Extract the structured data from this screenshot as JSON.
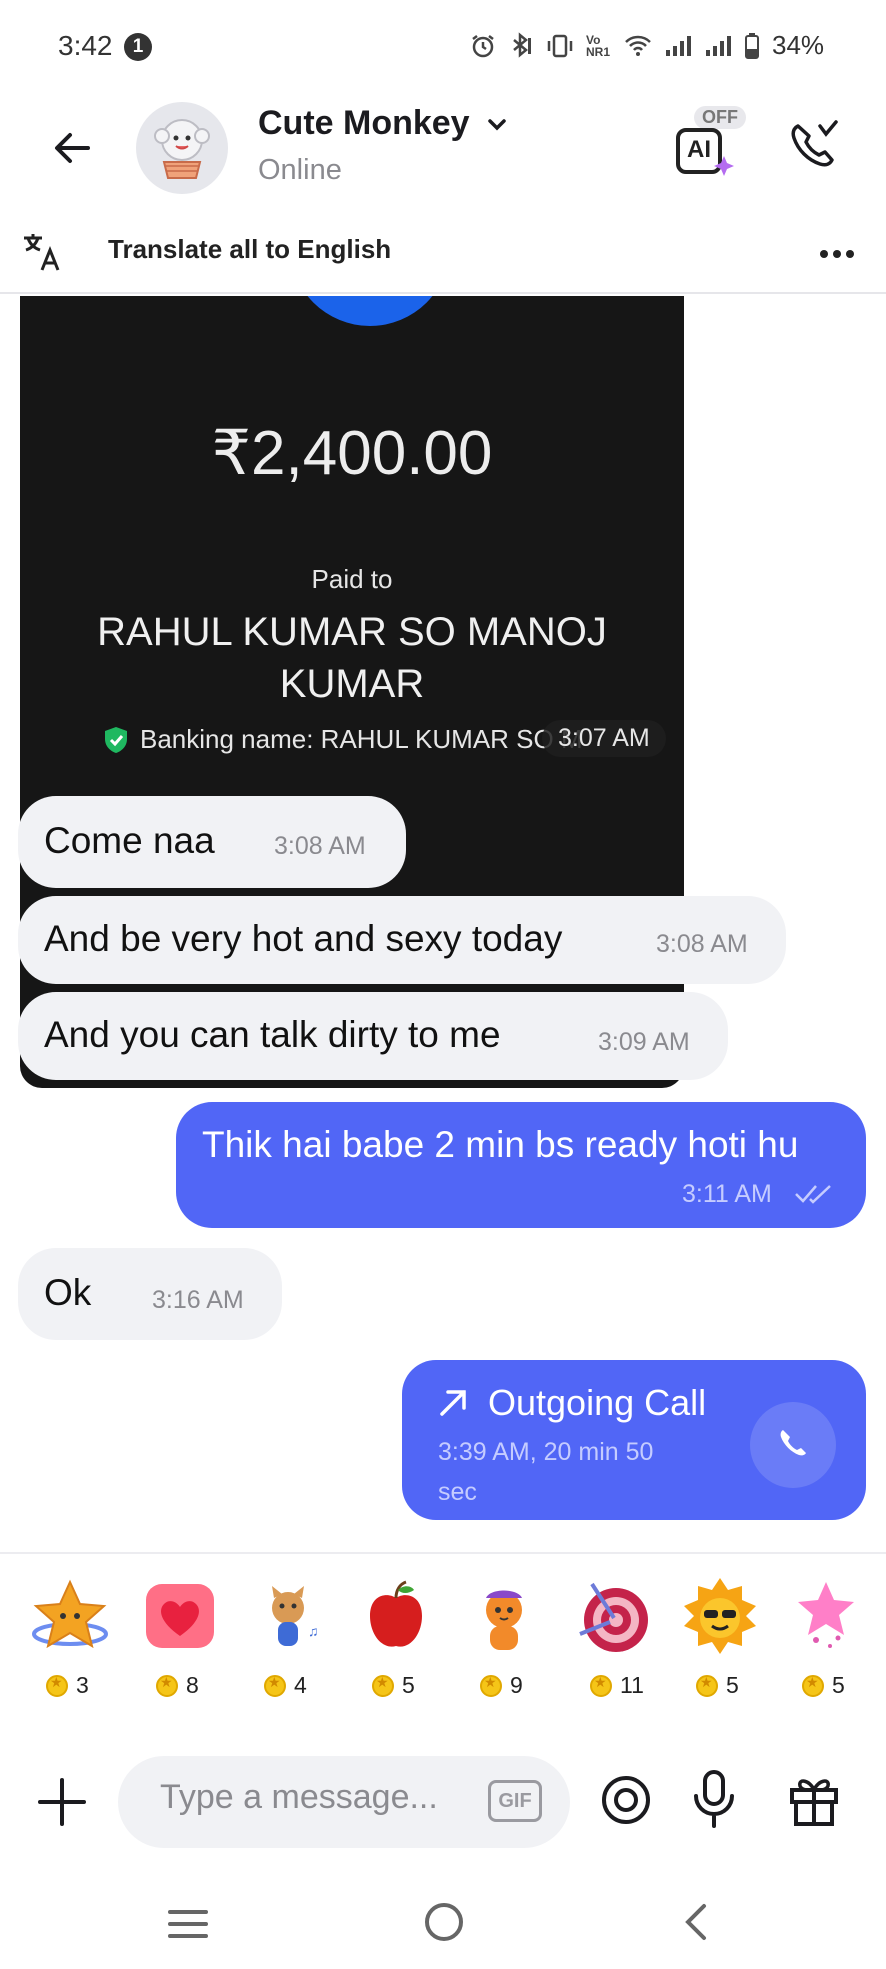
{
  "status_bar": {
    "time": "3:42",
    "notification_count": "1",
    "network_label": "Vo NR1",
    "battery": "34%"
  },
  "header": {
    "contact_name": "Cute Monkey",
    "contact_status": "Online",
    "ai_toggle_state": "OFF",
    "ai_label": "AI"
  },
  "translate_bar": {
    "label": "Translate all to English"
  },
  "payment": {
    "amount": "₹2,400.00",
    "paid_to_label": "Paid to",
    "payee_name": "RAHUL KUMAR SO MANOJ KUMAR",
    "banking_name": "Banking name: RAHUL KUMAR SO M",
    "time": "3:07 AM"
  },
  "messages": [
    {
      "direction": "in",
      "text": "Come naa",
      "time": "3:08 AM"
    },
    {
      "direction": "in",
      "text": "And be very hot and sexy today",
      "time": "3:08 AM"
    },
    {
      "direction": "in",
      "text": "And you can talk dirty to me",
      "time": "3:09 AM"
    },
    {
      "direction": "out",
      "text": "Thik hai babe 2 min bs ready hoti hu",
      "time": "3:11 AM",
      "read": true
    },
    {
      "direction": "in",
      "text": "Ok",
      "time": "3:16 AM"
    }
  ],
  "call_log": {
    "title": "Outgoing Call",
    "meta": "3:39 AM, 20 min 50 sec"
  },
  "gifts": [
    {
      "icon": "star-gift-icon",
      "cost": "3"
    },
    {
      "icon": "heart-gift-icon",
      "cost": "8"
    },
    {
      "icon": "cat-gift-icon",
      "cost": "4"
    },
    {
      "icon": "apple-gift-icon",
      "cost": "5"
    },
    {
      "icon": "tiger-gift-icon",
      "cost": "9"
    },
    {
      "icon": "target-gift-icon",
      "cost": "11"
    },
    {
      "icon": "sun-gift-icon",
      "cost": "5"
    },
    {
      "icon": "pink-star-gift-icon",
      "cost": "5"
    }
  ],
  "input": {
    "placeholder": "Type a message...",
    "gif_label": "GIF"
  },
  "colors": {
    "outgoing_bubble": "#5166f6",
    "incoming_bubble": "#f1f2f5",
    "payment_card": "#161616",
    "accent_blue": "#1b63ea"
  }
}
